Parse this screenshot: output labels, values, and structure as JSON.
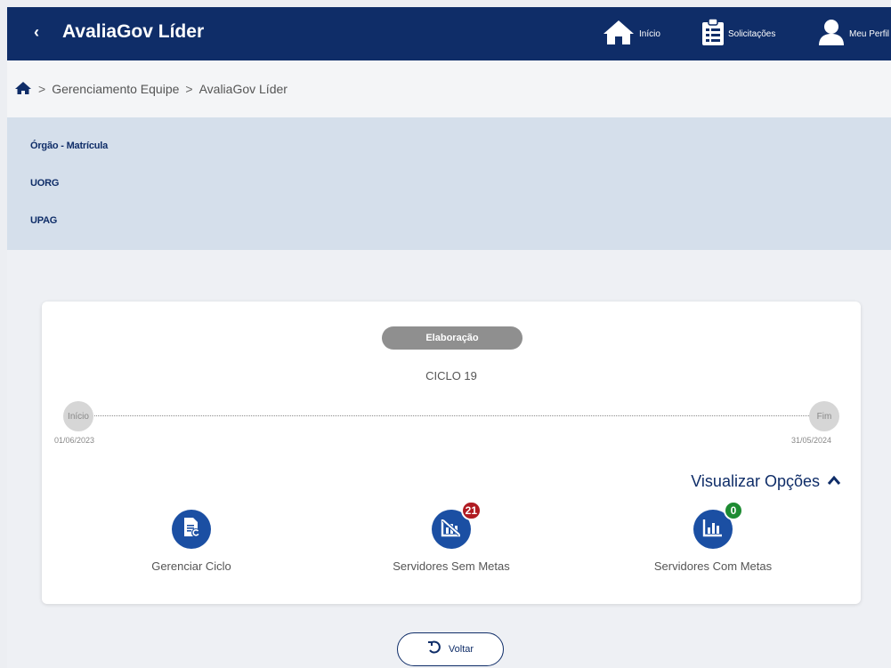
{
  "header": {
    "back_icon": "chevron-left-icon",
    "title": "AvaliaGov Líder",
    "nav": [
      {
        "icon": "home-icon",
        "label": "Início"
      },
      {
        "icon": "clipboard-list-icon",
        "label": "Solicitações"
      },
      {
        "icon": "user-icon",
        "label": "Meu Perfil"
      }
    ]
  },
  "breadcrumb": {
    "home_icon": "home-icon",
    "items": [
      "Gerenciamento Equipe",
      "AvaliaGov Líder"
    ]
  },
  "info": {
    "orgao_label": "Órgão - Matrícula",
    "uorg_label": "UORG",
    "upag_label": "UPAG"
  },
  "cycle": {
    "status": "Elaboração",
    "name": "CICLO 19",
    "start_label": "Início",
    "start_date": "01/06/2023",
    "end_label": "Fim",
    "end_date": "31/05/2024"
  },
  "options": {
    "toggle_label": "Visualizar Opções",
    "actions": [
      {
        "label": "Gerenciar Ciclo",
        "icon": "document-cycle-icon",
        "badge": null
      },
      {
        "label": "Servidores Sem Metas",
        "icon": "chart-off-icon",
        "badge": "21",
        "badge_color": "#b01b22"
      },
      {
        "label": "Servidores Com Metas",
        "icon": "bar-chart-icon",
        "badge": "0",
        "badge_color": "#1d8b32"
      }
    ]
  },
  "footer": {
    "back_label": "Voltar",
    "back_icon": "undo-icon"
  },
  "colors": {
    "primary": "#0f2d68",
    "action_blue": "#1b4fa3",
    "info_bg": "#d5dfeb"
  }
}
